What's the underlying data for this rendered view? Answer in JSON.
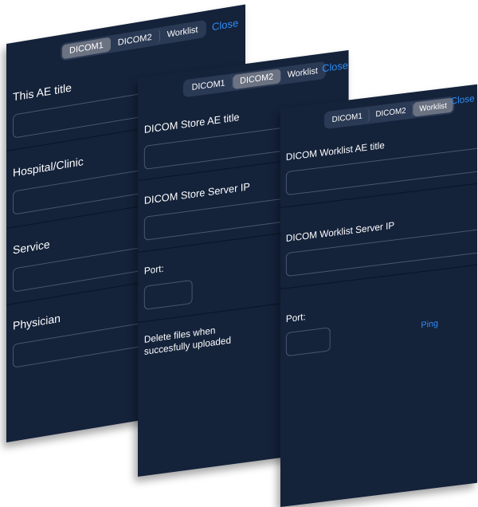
{
  "tabs": [
    "DICOM1",
    "DICOM2",
    "Worklist"
  ],
  "close_label": "Close",
  "dicom1": {
    "fields": [
      "This AE title",
      "Hospital/Clinic",
      "Service",
      "Physician"
    ]
  },
  "dicom2": {
    "store_ae_label": "DICOM Store AE title",
    "store_ip_label": "DICOM Store Server IP",
    "port_label": "Port:",
    "delete_line1": "Delete files when",
    "delete_line2": "succesfully uploaded"
  },
  "worklist": {
    "ae_label": "DICOM Worklist AE title",
    "ip_label": "DICOM Worklist Server IP",
    "port_label": "Port:",
    "ping_label": "Ping"
  },
  "colors": {
    "background": "#14223a",
    "accent": "#2f8cf5",
    "active_tab": "#6b7281"
  }
}
